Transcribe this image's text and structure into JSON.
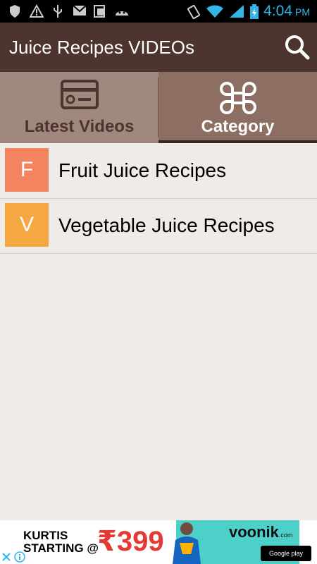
{
  "status_bar": {
    "time": "4:04",
    "ampm": "PM",
    "icons": [
      "shield-icon",
      "warning-icon",
      "usb-icon",
      "mail-icon",
      "sim-icon",
      "android-icon",
      "vibrate-icon",
      "wifi-icon",
      "signal-icon",
      "battery-icon"
    ]
  },
  "app_bar": {
    "title": "Juice Recipes VIDEOs",
    "search_icon": "search-icon"
  },
  "tabs": [
    {
      "label": "Latest Videos",
      "icon": "video-card-icon",
      "selected": false
    },
    {
      "label": "Category",
      "icon": "command-icon",
      "selected": true
    }
  ],
  "categories": [
    {
      "letter": "F",
      "label": "Fruit Juice Recipes",
      "color": "#f4845f"
    },
    {
      "letter": "V",
      "label": "Vegetable Juice Recipes",
      "color": "#f5a742"
    }
  ],
  "ad": {
    "headline_line1": "KURTIS",
    "headline_line2": "STARTING @",
    "price": "₹399",
    "brand": "voonik",
    "brand_suffix": ".com",
    "store_badge": "Google play"
  },
  "colors": {
    "app_bar": "#4e342e",
    "tab_bar": "#8d6e63",
    "background": "#efebe9"
  }
}
